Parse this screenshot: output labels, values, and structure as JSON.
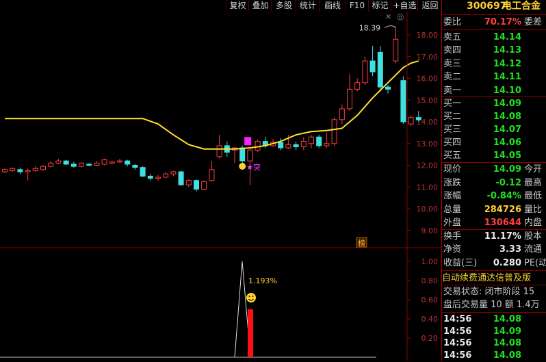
{
  "toolbar": {
    "buttons": [
      "复权",
      "叠加",
      "多股",
      "统计",
      "画线",
      "F10",
      "标记",
      "+自选",
      "返回"
    ],
    "close_glyph": "✕",
    "settings_glyph": "◎"
  },
  "kline": {
    "y_ticks": [
      "18.00",
      "17.00",
      "16.00",
      "15.00",
      "14.00",
      "13.00",
      "12.00",
      "11.00",
      "10.00",
      "9.00"
    ],
    "max_label": "18.39",
    "badge_text": "突",
    "rank_badge": "榜",
    "candles": [
      {
        "o": 11.7,
        "c": 11.8,
        "h": 11.85,
        "l": 11.65
      },
      {
        "o": 11.75,
        "c": 11.85,
        "h": 11.9,
        "l": 11.7
      },
      {
        "o": 11.8,
        "c": 11.7,
        "h": 11.9,
        "l": 11.6
      },
      {
        "o": 11.7,
        "c": 11.75,
        "h": 11.85,
        "l": 11.3
      },
      {
        "o": 11.75,
        "c": 11.85,
        "h": 11.95,
        "l": 11.7
      },
      {
        "o": 11.8,
        "c": 11.95,
        "h": 12.0,
        "l": 11.75
      },
      {
        "o": 11.95,
        "c": 12.1,
        "h": 12.2,
        "l": 11.9
      },
      {
        "o": 12.1,
        "c": 12.2,
        "h": 12.3,
        "l": 12.05
      },
      {
        "o": 12.2,
        "c": 12.05,
        "h": 12.25,
        "l": 12.0
      },
      {
        "o": 12.05,
        "c": 11.95,
        "h": 12.15,
        "l": 11.9
      },
      {
        "o": 11.95,
        "c": 12.1,
        "h": 12.15,
        "l": 11.9
      },
      {
        "o": 12.05,
        "c": 12.0,
        "h": 12.1,
        "l": 11.95
      },
      {
        "o": 12.0,
        "c": 12.1,
        "h": 12.2,
        "l": 11.95
      },
      {
        "o": 12.05,
        "c": 12.25,
        "h": 12.3,
        "l": 12.0
      },
      {
        "o": 12.1,
        "c": 12.15,
        "h": 12.2,
        "l": 12.05
      },
      {
        "o": 12.15,
        "c": 12.2,
        "h": 12.3,
        "l": 12.1
      },
      {
        "o": 12.2,
        "c": 12.05,
        "h": 12.25,
        "l": 11.95
      },
      {
        "o": 12.0,
        "c": 11.9,
        "h": 12.05,
        "l": 11.8
      },
      {
        "o": 11.9,
        "c": 11.5,
        "h": 11.95,
        "l": 11.45
      },
      {
        "o": 11.5,
        "c": 11.4,
        "h": 11.6,
        "l": 11.3
      },
      {
        "o": 11.4,
        "c": 11.45,
        "h": 11.55,
        "l": 11.3
      },
      {
        "o": 11.45,
        "c": 11.6,
        "h": 11.7,
        "l": 11.4
      },
      {
        "o": 11.6,
        "c": 11.7,
        "h": 11.75,
        "l": 11.5
      },
      {
        "o": 11.7,
        "c": 11.1,
        "h": 11.75,
        "l": 11.05
      },
      {
        "o": 11.1,
        "c": 11.3,
        "h": 11.35,
        "l": 11.0
      },
      {
        "o": 11.3,
        "c": 10.9,
        "h": 11.35,
        "l": 10.8
      },
      {
        "o": 10.9,
        "c": 11.25,
        "h": 11.3,
        "l": 10.85
      },
      {
        "o": 11.3,
        "c": 11.8,
        "h": 12.2,
        "l": 11.25
      },
      {
        "o": 12.4,
        "c": 12.9,
        "h": 13.4,
        "l": 12.3
      },
      {
        "o": 12.9,
        "c": 12.6,
        "h": 13.1,
        "l": 12.4
      },
      {
        "o": 12.7,
        "c": 12.8,
        "h": 12.85,
        "l": 12.1
      },
      {
        "o": 12.8,
        "c": 12.2,
        "h": 12.9,
        "l": 12.1
      },
      {
        "o": 12.2,
        "c": 12.7,
        "h": 12.8,
        "l": 11.1
      },
      {
        "o": 12.7,
        "c": 13.1,
        "h": 13.2,
        "l": 12.6
      },
      {
        "o": 13.1,
        "c": 12.9,
        "h": 13.3,
        "l": 12.8
      },
      {
        "o": 12.9,
        "c": 13.05,
        "h": 13.2,
        "l": 12.85
      },
      {
        "o": 13.05,
        "c": 12.8,
        "h": 13.25,
        "l": 12.7
      },
      {
        "o": 12.8,
        "c": 12.95,
        "h": 13.4,
        "l": 12.75
      },
      {
        "o": 12.95,
        "c": 12.85,
        "h": 13.1,
        "l": 12.7
      },
      {
        "o": 12.85,
        "c": 13.1,
        "h": 13.3,
        "l": 12.7
      },
      {
        "o": 13.0,
        "c": 13.3,
        "h": 13.4,
        "l": 12.8
      },
      {
        "o": 13.3,
        "c": 12.9,
        "h": 13.4,
        "l": 12.8
      },
      {
        "o": 12.9,
        "c": 13.0,
        "h": 13.5,
        "l": 12.8
      },
      {
        "o": 13.0,
        "c": 14.1,
        "h": 14.2,
        "l": 12.9
      },
      {
        "o": 14.1,
        "c": 14.6,
        "h": 14.8,
        "l": 13.9
      },
      {
        "o": 14.6,
        "c": 15.5,
        "h": 16.2,
        "l": 14.5
      },
      {
        "o": 15.5,
        "c": 15.8,
        "h": 16.0,
        "l": 15.4
      },
      {
        "o": 15.8,
        "c": 16.8,
        "h": 17.0,
        "l": 15.7
      },
      {
        "o": 16.8,
        "c": 16.3,
        "h": 17.5,
        "l": 16.1
      },
      {
        "o": 17.2,
        "c": 15.6,
        "h": 17.5,
        "l": 15.4
      },
      {
        "o": 15.6,
        "c": 15.5,
        "h": 15.7,
        "l": 15.3
      },
      {
        "o": 16.8,
        "c": 17.8,
        "h": 18.39,
        "l": 16.7
      },
      {
        "o": 15.9,
        "c": 14.0,
        "h": 16.1,
        "l": 13.9
      },
      {
        "o": 13.9,
        "c": 14.2,
        "h": 14.3,
        "l": 13.8
      },
      {
        "o": 14.2,
        "c": 14.09,
        "h": 14.5,
        "l": 14.0
      }
    ],
    "ma": [
      {
        "x": 0,
        "y": 14.15
      },
      {
        "x": 18,
        "y": 14.15
      },
      {
        "x": 20,
        "y": 13.9
      },
      {
        "x": 22,
        "y": 13.4
      },
      {
        "x": 24,
        "y": 12.95
      },
      {
        "x": 26,
        "y": 12.75
      },
      {
        "x": 28,
        "y": 12.75
      },
      {
        "x": 30,
        "y": 12.75
      },
      {
        "x": 32,
        "y": 12.8
      },
      {
        "x": 34,
        "y": 12.9
      },
      {
        "x": 36,
        "y": 13.1
      },
      {
        "x": 38,
        "y": 13.4
      },
      {
        "x": 40,
        "y": 13.55
      },
      {
        "x": 42,
        "y": 13.6
      },
      {
        "x": 44,
        "y": 13.7
      },
      {
        "x": 46,
        "y": 14.3
      },
      {
        "x": 48,
        "y": 15.1
      },
      {
        "x": 50,
        "y": 15.8
      },
      {
        "x": 52,
        "y": 16.5
      },
      {
        "x": 53,
        "y": 16.7
      },
      {
        "x": 54,
        "y": 16.8
      }
    ]
  },
  "indicator": {
    "y_ticks": [
      "1.00",
      "0.80",
      "0.60",
      "0.40",
      "0.20"
    ],
    "peak_label": "1.193%",
    "peak_value": 1.0,
    "bar_value": 0.5
  },
  "quote": {
    "code": "300697",
    "name": "电工合金",
    "weibi": {
      "label": "委比",
      "value": "70.17%",
      "tail": "委差"
    },
    "sell": [
      {
        "label": "卖五",
        "price": "14.14"
      },
      {
        "label": "卖四",
        "price": "14.13"
      },
      {
        "label": "卖三",
        "price": "14.12"
      },
      {
        "label": "卖二",
        "price": "14.11"
      },
      {
        "label": "卖一",
        "price": "14.10"
      }
    ],
    "buy": [
      {
        "label": "买一",
        "price": "14.09"
      },
      {
        "label": "买二",
        "price": "14.08"
      },
      {
        "label": "买三",
        "price": "14.07"
      },
      {
        "label": "买四",
        "price": "14.06"
      },
      {
        "label": "买五",
        "price": "14.05"
      }
    ],
    "stats": [
      {
        "label": "现价",
        "value": "14.09",
        "tail": "今开",
        "color": "green"
      },
      {
        "label": "涨跌",
        "value": "-0.12",
        "tail": "最高",
        "color": "green"
      },
      {
        "label": "涨幅",
        "value": "-0.84%",
        "tail": "最低",
        "color": "green"
      },
      {
        "label": "总量",
        "value": "284726",
        "tail": "量比",
        "color": "yellow"
      },
      {
        "label": "外盘",
        "value": "130644",
        "tail": "内盘",
        "color": "red"
      }
    ],
    "fundamentals": [
      {
        "label": "换手",
        "value": "11.17%",
        "tail": "股本"
      },
      {
        "label": "净资",
        "value": "3.33",
        "tail": "流通"
      },
      {
        "label": "收益(三)",
        "value": "0.280",
        "tail": "PE(动"
      }
    ],
    "notice": "自动续费通达信普及版",
    "trade_status": "交易状态: 闭市阶段 15",
    "after_hours": "盘后交易量 10 额 1.4万",
    "ticks": [
      {
        "time": "14:56",
        "price": "14.08"
      },
      {
        "time": "14:56",
        "price": "14.09"
      },
      {
        "time": "14:56",
        "price": "14.08"
      },
      {
        "time": "14:56",
        "price": "14.08"
      }
    ]
  }
}
